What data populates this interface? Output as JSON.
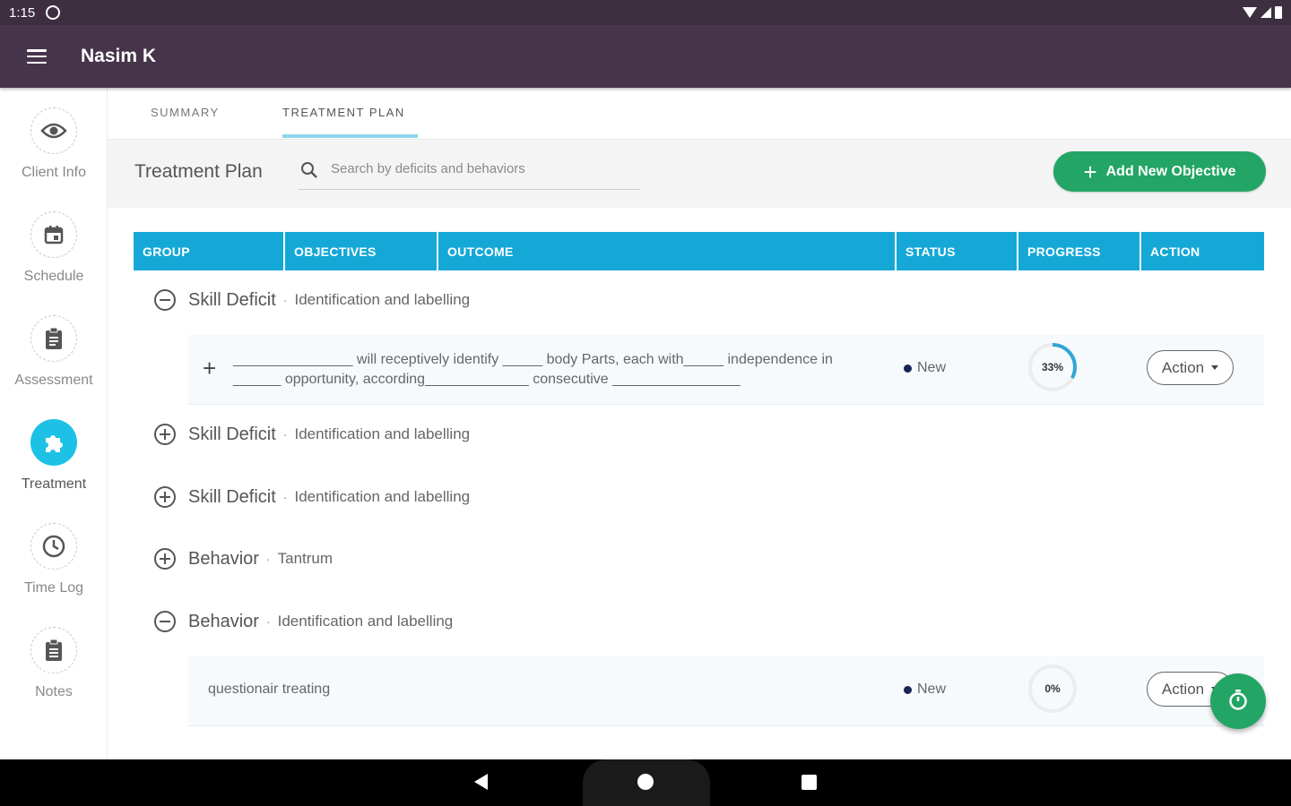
{
  "status_bar": {
    "time": "1:15"
  },
  "app_bar": {
    "title": "Nasim K"
  },
  "sidebar": {
    "items": [
      {
        "label": "Client Info",
        "icon": "eye-icon"
      },
      {
        "label": "Schedule",
        "icon": "calendar-icon"
      },
      {
        "label": "Assessment",
        "icon": "clipboard-icon"
      },
      {
        "label": "Treatment",
        "icon": "puzzle-icon",
        "active": true
      },
      {
        "label": "Time Log",
        "icon": "clock-icon"
      },
      {
        "label": "Notes",
        "icon": "notes-icon"
      }
    ]
  },
  "tabs": [
    {
      "label": "SUMMARY"
    },
    {
      "label": "TREATMENT PLAN",
      "active": true
    }
  ],
  "header": {
    "title": "Treatment Plan",
    "search_placeholder": "Search by deficits and behaviors",
    "add_button": "Add New Objective"
  },
  "table": {
    "columns": [
      "GROUP",
      "OBJECTIVES",
      "OUTCOME",
      "STATUS",
      "PROGRESS",
      "ACTION"
    ]
  },
  "groups": [
    {
      "name": "Skill Deficit",
      "sub": "Identification and labelling",
      "expanded": true,
      "objectives": [
        {
          "line1": "_______________ will receptively identify _____ body Parts, each with_____ independence in",
          "line2": "______ opportunity, according_____________ consecutive ________________",
          "status": "New",
          "progress": 0.33,
          "progress_label": "33%",
          "action": "Action"
        }
      ]
    },
    {
      "name": "Skill Deficit",
      "sub": "Identification and labelling",
      "expanded": false
    },
    {
      "name": "Skill Deficit",
      "sub": "Identification and labelling",
      "expanded": false
    },
    {
      "name": "Behavior",
      "sub": "Tantrum",
      "expanded": false
    },
    {
      "name": "Behavior",
      "sub": "Identification and labelling",
      "expanded": true,
      "objectives": [
        {
          "text": "questionair treating",
          "status": "New",
          "progress": 0,
          "progress_label": "0%",
          "action": "Action"
        }
      ]
    }
  ],
  "colors": {
    "app_bar": "#46344b",
    "status_bar": "#3d2e40",
    "table_header": "#15a8d6",
    "primary_green": "#23a565",
    "active_nav": "#1ec1e6"
  }
}
